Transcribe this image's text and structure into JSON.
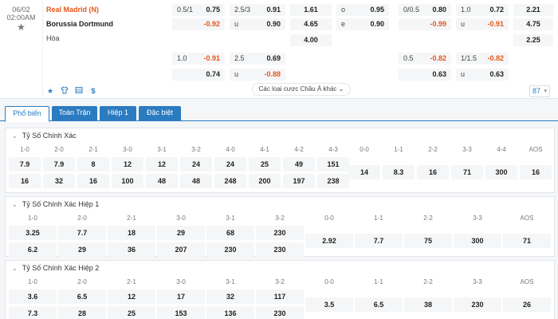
{
  "match": {
    "date": "06/02",
    "time": "02:00AM",
    "home_team": "Real Madrid (N)",
    "away_team": "Borussia Dortmund",
    "draw_label": "Hòa"
  },
  "odds_full": {
    "handicap": {
      "line": "0.5/1",
      "home": "0.75",
      "away": "-0.92"
    },
    "total": {
      "line": "2.5/3",
      "over": "0.91",
      "under_label": "u",
      "under": "0.90"
    },
    "x12": {
      "home": "1.61",
      "away": "4.65",
      "draw": "4.00"
    },
    "oddeven": {
      "odd_label": "o",
      "odd": "0.95",
      "even_label": "e",
      "even": "0.90"
    }
  },
  "odds_half": {
    "handicap": {
      "line": "0/0.5",
      "home": "0.80",
      "away": "-0.99"
    },
    "total": {
      "line": "1.0",
      "over": "0.72",
      "under_label": "u",
      "under": "-0.91"
    },
    "x12": {
      "home": "2.21",
      "away": "4.75",
      "draw": "2.25"
    }
  },
  "odds_full_alt": {
    "handicap": {
      "line": "1.0",
      "home": "-0.91",
      "away": "0.74"
    },
    "total": {
      "line": "2.5",
      "over": "0.69",
      "under_label": "u",
      "under": "-0.88"
    }
  },
  "odds_half_alt": {
    "handicap": {
      "line": "0.5",
      "home": "-0.82",
      "away": "0.63"
    },
    "total": {
      "line": "1/1.5",
      "over": "-0.82",
      "under_label": "u",
      "under": "0.63"
    }
  },
  "toolbar": {
    "asian_label": "Các loại cược Châu Á khác",
    "page_count": "87",
    "icons": [
      "star-icon",
      "shirt-icon",
      "stats-icon",
      "dollar-icon"
    ]
  },
  "tabs": [
    {
      "label": "Phổ biến"
    },
    {
      "label": "Toàn Trận"
    },
    {
      "label": "Hiệp 1"
    },
    {
      "label": "Đặc biệt"
    }
  ],
  "sections": [
    {
      "title": "Tỷ Số Chính Xác",
      "home_heads": [
        "1-0",
        "2-0",
        "2-1",
        "3-0",
        "3-1",
        "3-2",
        "4-0",
        "4-1",
        "4-2",
        "4-3"
      ],
      "home_vals": [
        "7.9",
        "7.9",
        "8",
        "12",
        "12",
        "24",
        "24",
        "25",
        "49",
        "151"
      ],
      "away_vals": [
        "16",
        "32",
        "16",
        "100",
        "48",
        "48",
        "248",
        "200",
        "197",
        "238"
      ],
      "draw_heads": [
        "0-0",
        "1-1",
        "2-2",
        "3-3",
        "4-4",
        "AOS"
      ],
      "draw_vals": [
        "14",
        "8.3",
        "16",
        "71",
        "300",
        "16"
      ]
    },
    {
      "title": "Tỷ Số Chính Xác Hiệp 1",
      "home_heads": [
        "1-0",
        "2-0",
        "2-1",
        "3-0",
        "3-1",
        "3-2"
      ],
      "home_vals": [
        "3.25",
        "7.7",
        "18",
        "29",
        "68",
        "230"
      ],
      "away_vals": [
        "6.2",
        "29",
        "36",
        "207",
        "230",
        "230"
      ],
      "draw_heads": [
        "0-0",
        "1-1",
        "2-2",
        "3-3",
        "AOS"
      ],
      "draw_vals": [
        "2.92",
        "7.7",
        "75",
        "300",
        "71"
      ]
    },
    {
      "title": "Tỷ Số Chính Xác Hiệp 2",
      "home_heads": [
        "1-0",
        "2-0",
        "2-1",
        "3-0",
        "3-1",
        "3-2"
      ],
      "home_vals": [
        "3.6",
        "6.5",
        "12",
        "17",
        "32",
        "117"
      ],
      "away_vals": [
        "7.3",
        "28",
        "25",
        "153",
        "136",
        "230"
      ],
      "draw_heads": [
        "0-0",
        "1-1",
        "2-2",
        "3-3",
        "AOS"
      ],
      "draw_vals": [
        "3.5",
        "6.5",
        "38",
        "230",
        "26"
      ]
    }
  ]
}
